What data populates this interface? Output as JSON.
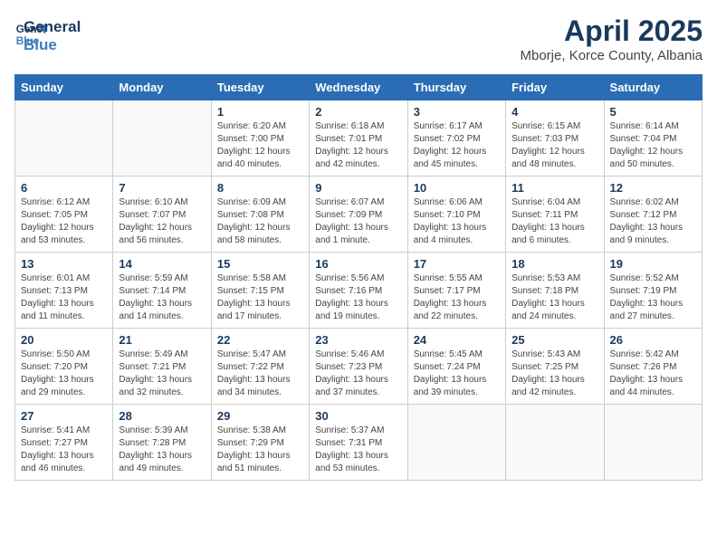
{
  "header": {
    "logo_line1": "General",
    "logo_line2": "Blue",
    "title": "April 2025",
    "subtitle": "Mborje, Korce County, Albania"
  },
  "weekdays": [
    "Sunday",
    "Monday",
    "Tuesday",
    "Wednesday",
    "Thursday",
    "Friday",
    "Saturday"
  ],
  "weeks": [
    [
      {
        "day": "",
        "info": ""
      },
      {
        "day": "",
        "info": ""
      },
      {
        "day": "1",
        "info": "Sunrise: 6:20 AM\nSunset: 7:00 PM\nDaylight: 12 hours and 40 minutes."
      },
      {
        "day": "2",
        "info": "Sunrise: 6:18 AM\nSunset: 7:01 PM\nDaylight: 12 hours and 42 minutes."
      },
      {
        "day": "3",
        "info": "Sunrise: 6:17 AM\nSunset: 7:02 PM\nDaylight: 12 hours and 45 minutes."
      },
      {
        "day": "4",
        "info": "Sunrise: 6:15 AM\nSunset: 7:03 PM\nDaylight: 12 hours and 48 minutes."
      },
      {
        "day": "5",
        "info": "Sunrise: 6:14 AM\nSunset: 7:04 PM\nDaylight: 12 hours and 50 minutes."
      }
    ],
    [
      {
        "day": "6",
        "info": "Sunrise: 6:12 AM\nSunset: 7:05 PM\nDaylight: 12 hours and 53 minutes."
      },
      {
        "day": "7",
        "info": "Sunrise: 6:10 AM\nSunset: 7:07 PM\nDaylight: 12 hours and 56 minutes."
      },
      {
        "day": "8",
        "info": "Sunrise: 6:09 AM\nSunset: 7:08 PM\nDaylight: 12 hours and 58 minutes."
      },
      {
        "day": "9",
        "info": "Sunrise: 6:07 AM\nSunset: 7:09 PM\nDaylight: 13 hours and 1 minute."
      },
      {
        "day": "10",
        "info": "Sunrise: 6:06 AM\nSunset: 7:10 PM\nDaylight: 13 hours and 4 minutes."
      },
      {
        "day": "11",
        "info": "Sunrise: 6:04 AM\nSunset: 7:11 PM\nDaylight: 13 hours and 6 minutes."
      },
      {
        "day": "12",
        "info": "Sunrise: 6:02 AM\nSunset: 7:12 PM\nDaylight: 13 hours and 9 minutes."
      }
    ],
    [
      {
        "day": "13",
        "info": "Sunrise: 6:01 AM\nSunset: 7:13 PM\nDaylight: 13 hours and 11 minutes."
      },
      {
        "day": "14",
        "info": "Sunrise: 5:59 AM\nSunset: 7:14 PM\nDaylight: 13 hours and 14 minutes."
      },
      {
        "day": "15",
        "info": "Sunrise: 5:58 AM\nSunset: 7:15 PM\nDaylight: 13 hours and 17 minutes."
      },
      {
        "day": "16",
        "info": "Sunrise: 5:56 AM\nSunset: 7:16 PM\nDaylight: 13 hours and 19 minutes."
      },
      {
        "day": "17",
        "info": "Sunrise: 5:55 AM\nSunset: 7:17 PM\nDaylight: 13 hours and 22 minutes."
      },
      {
        "day": "18",
        "info": "Sunrise: 5:53 AM\nSunset: 7:18 PM\nDaylight: 13 hours and 24 minutes."
      },
      {
        "day": "19",
        "info": "Sunrise: 5:52 AM\nSunset: 7:19 PM\nDaylight: 13 hours and 27 minutes."
      }
    ],
    [
      {
        "day": "20",
        "info": "Sunrise: 5:50 AM\nSunset: 7:20 PM\nDaylight: 13 hours and 29 minutes."
      },
      {
        "day": "21",
        "info": "Sunrise: 5:49 AM\nSunset: 7:21 PM\nDaylight: 13 hours and 32 minutes."
      },
      {
        "day": "22",
        "info": "Sunrise: 5:47 AM\nSunset: 7:22 PM\nDaylight: 13 hours and 34 minutes."
      },
      {
        "day": "23",
        "info": "Sunrise: 5:46 AM\nSunset: 7:23 PM\nDaylight: 13 hours and 37 minutes."
      },
      {
        "day": "24",
        "info": "Sunrise: 5:45 AM\nSunset: 7:24 PM\nDaylight: 13 hours and 39 minutes."
      },
      {
        "day": "25",
        "info": "Sunrise: 5:43 AM\nSunset: 7:25 PM\nDaylight: 13 hours and 42 minutes."
      },
      {
        "day": "26",
        "info": "Sunrise: 5:42 AM\nSunset: 7:26 PM\nDaylight: 13 hours and 44 minutes."
      }
    ],
    [
      {
        "day": "27",
        "info": "Sunrise: 5:41 AM\nSunset: 7:27 PM\nDaylight: 13 hours and 46 minutes."
      },
      {
        "day": "28",
        "info": "Sunrise: 5:39 AM\nSunset: 7:28 PM\nDaylight: 13 hours and 49 minutes."
      },
      {
        "day": "29",
        "info": "Sunrise: 5:38 AM\nSunset: 7:29 PM\nDaylight: 13 hours and 51 minutes."
      },
      {
        "day": "30",
        "info": "Sunrise: 5:37 AM\nSunset: 7:31 PM\nDaylight: 13 hours and 53 minutes."
      },
      {
        "day": "",
        "info": ""
      },
      {
        "day": "",
        "info": ""
      },
      {
        "day": "",
        "info": ""
      }
    ]
  ]
}
